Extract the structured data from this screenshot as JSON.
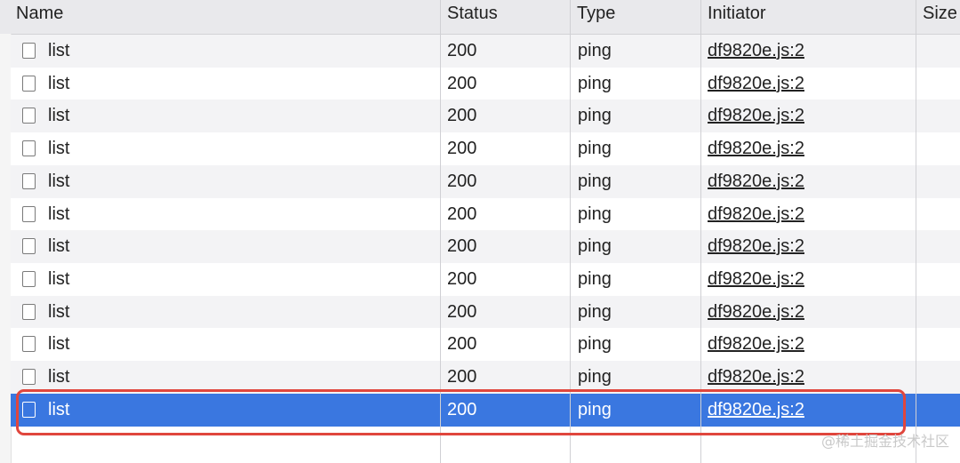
{
  "columns": {
    "name": "Name",
    "status": "Status",
    "type": "Type",
    "initiator": "Initiator",
    "size": "Size"
  },
  "rows": [
    {
      "name": "list",
      "status": "200",
      "type": "ping",
      "initiator": "df9820e.js:2"
    },
    {
      "name": "list",
      "status": "200",
      "type": "ping",
      "initiator": "df9820e.js:2"
    },
    {
      "name": "list",
      "status": "200",
      "type": "ping",
      "initiator": "df9820e.js:2"
    },
    {
      "name": "list",
      "status": "200",
      "type": "ping",
      "initiator": "df9820e.js:2"
    },
    {
      "name": "list",
      "status": "200",
      "type": "ping",
      "initiator": "df9820e.js:2"
    },
    {
      "name": "list",
      "status": "200",
      "type": "ping",
      "initiator": "df9820e.js:2"
    },
    {
      "name": "list",
      "status": "200",
      "type": "ping",
      "initiator": "df9820e.js:2"
    },
    {
      "name": "list",
      "status": "200",
      "type": "ping",
      "initiator": "df9820e.js:2"
    },
    {
      "name": "list",
      "status": "200",
      "type": "ping",
      "initiator": "df9820e.js:2"
    },
    {
      "name": "list",
      "status": "200",
      "type": "ping",
      "initiator": "df9820e.js:2"
    },
    {
      "name": "list",
      "status": "200",
      "type": "ping",
      "initiator": "df9820e.js:2"
    },
    {
      "name": "list",
      "status": "200",
      "type": "ping",
      "initiator": "df9820e.js:2",
      "selected": true
    }
  ],
  "watermark": "@稀土掘金技术社区",
  "colors": {
    "selected_row": "#3a77e0",
    "highlight_box": "#e0463d",
    "header_bg": "#e9e9ec"
  }
}
